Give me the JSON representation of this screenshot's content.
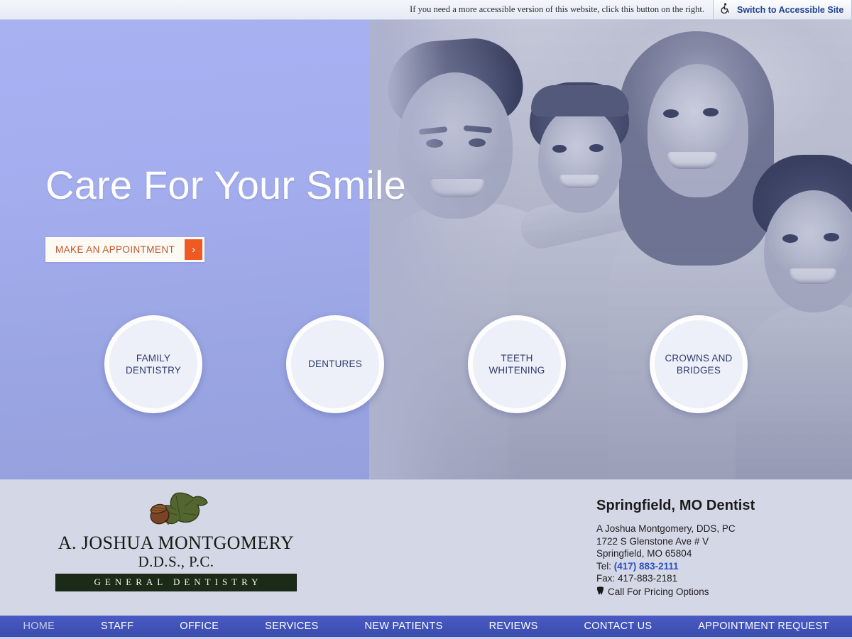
{
  "accessibility_bar": {
    "note": "If you need a more accessible version of this website, click this button on the right.",
    "button_label": "Switch to Accessible Site",
    "icon": "wheelchair-accessible-icon"
  },
  "hero": {
    "title": "Care For Your Smile",
    "cta_label": "MAKE AN APPOINTMENT",
    "cta_arrow": "›",
    "accent_color": "#ef5a22",
    "background_color": "#a4aeef",
    "image_alt": "family of four smiling",
    "services": [
      {
        "label": "FAMILY\nDENTISTRY",
        "line1": "FAMILY",
        "line2": "DENTISTRY"
      },
      {
        "label": "DENTURES",
        "line1": "DENTURES",
        "line2": ""
      },
      {
        "label": "TEETH\nWHITENING",
        "line1": "TEETH",
        "line2": "WHITENING"
      },
      {
        "label": "CROWNS AND\nBRIDGES",
        "line1": "CROWNS AND",
        "line2": "BRIDGES"
      }
    ]
  },
  "logo": {
    "emblem": "acorn-oak-leaf-icon",
    "name": "A. JOSHUA MONTGOMERY",
    "degree": "D.D.S., P.C.",
    "tagline": "GENERAL DENTISTRY"
  },
  "contact": {
    "heading": "Springfield, MO Dentist",
    "practice": "A Joshua Montgomery, DDS, PC",
    "address_line1": "1722 S Glenstone Ave # V",
    "address_line2": "Springfield, MO 65804",
    "tel_label": "Tel:",
    "tel_number": "(417) 883-2111",
    "fax_label": "Fax:",
    "fax_number": "417-883-2181",
    "pricing_note": "Call For Pricing Options",
    "pricing_icon": "tooth-icon",
    "link_color": "#2a4fc4"
  },
  "nav": {
    "background_color": "#4153b8",
    "items": [
      {
        "label": "HOME",
        "active": true
      },
      {
        "label": "STAFF",
        "active": false
      },
      {
        "label": "OFFICE",
        "active": false
      },
      {
        "label": "SERVICES",
        "active": false
      },
      {
        "label": "NEW PATIENTS",
        "active": false
      },
      {
        "label": "REVIEWS",
        "active": false
      },
      {
        "label": "CONTACT US",
        "active": false
      },
      {
        "label": "APPOINTMENT REQUEST",
        "active": false
      }
    ]
  }
}
